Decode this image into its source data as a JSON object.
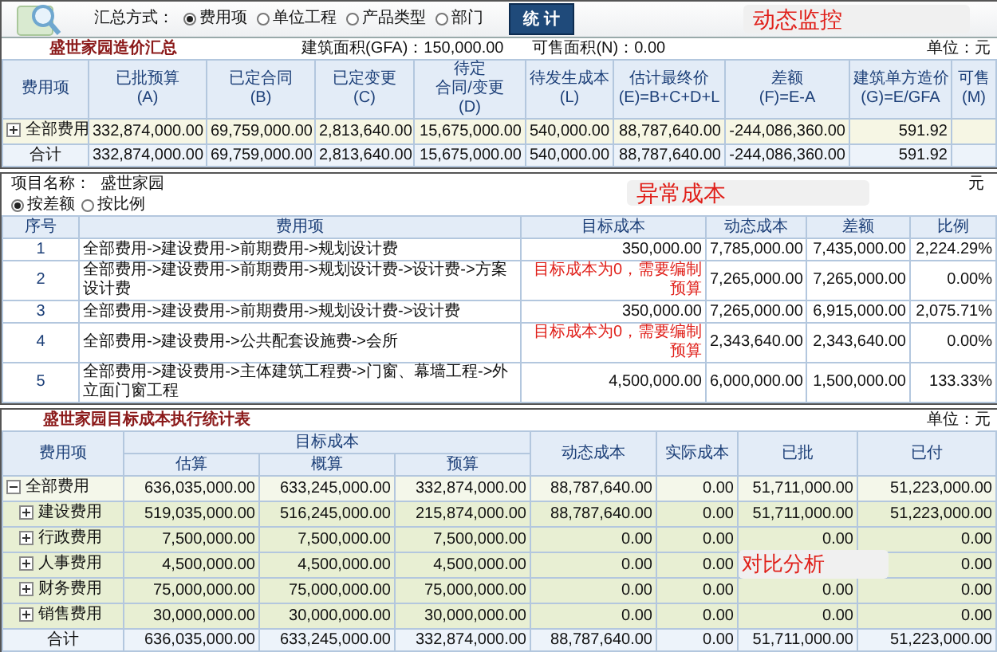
{
  "toolbar": {
    "summary_label": "汇总方式：",
    "summary_options": [
      {
        "label": "费用项",
        "selected": true
      },
      {
        "label": "单位工程",
        "selected": false
      },
      {
        "label": "产品类型",
        "selected": false
      },
      {
        "label": "部门",
        "selected": false
      }
    ],
    "button": "统 计",
    "annotation": "动态监控"
  },
  "cost_summary": {
    "title": "盛世家园造价汇总",
    "gfa": "建筑面积(GFA)：150,000.00",
    "saleable_area": "可售面积(N)：0.00",
    "unit": "单位：元",
    "columns": [
      [
        "费用项"
      ],
      [
        "已批预算",
        "(A)"
      ],
      [
        "已定合同",
        "(B)"
      ],
      [
        "已定变更",
        "(C)"
      ],
      [
        "待定",
        "合同/变更",
        "(D)"
      ],
      [
        "待发生成本",
        "(L)"
      ],
      [
        "估计最终价",
        "(E)=B+C+D+L"
      ],
      [
        "差额",
        "(F)=E-A"
      ],
      [
        "建筑单方造价",
        "(G)=E/GFA"
      ],
      [
        "可售",
        "(M)"
      ]
    ],
    "rows": [
      {
        "name": "全部费用",
        "expanded": false,
        "values": [
          "332,874,000.00",
          "69,759,000.00",
          "2,813,640.00",
          "15,675,000.00",
          "540,000.00",
          "88,787,640.00",
          "-244,086,360.00",
          "591.92"
        ]
      }
    ],
    "total": {
      "name": "合计",
      "values": [
        "332,874,000.00",
        "69,759,000.00",
        "2,813,640.00",
        "15,675,000.00",
        "540,000.00",
        "88,787,640.00",
        "-244,086,360.00",
        "591.92"
      ]
    }
  },
  "abnormal_cost": {
    "project_label": "项目名称：",
    "project_name": "盛世家园",
    "unit": "元",
    "annotation": "异常成本",
    "sort_options": [
      {
        "label": "按差额",
        "selected": true
      },
      {
        "label": "按比例",
        "selected": false
      }
    ],
    "columns": [
      "序号",
      "费用项",
      "目标成本",
      "动态成本",
      "差额",
      "比例"
    ],
    "rows": [
      {
        "no": "1",
        "item": "全部费用->建设费用->前期费用->规划设计费",
        "target": "350,000.00",
        "warning": false,
        "dynamic": "7,785,000.00",
        "difference": "7,435,000.00",
        "ratio": "2,224.29%"
      },
      {
        "no": "2",
        "item": "全部费用->建设费用->前期费用->规划设计费->设计费->方案设计费",
        "target": "目标成本为0，需要编制预算",
        "warning": true,
        "dynamic": "7,265,000.00",
        "difference": "7,265,000.00",
        "ratio": "0.00%"
      },
      {
        "no": "3",
        "item": "全部费用->建设费用->前期费用->规划设计费->设计费",
        "target": "350,000.00",
        "warning": false,
        "dynamic": "7,265,000.00",
        "difference": "6,915,000.00",
        "ratio": "2,075.71%"
      },
      {
        "no": "4",
        "item": "全部费用->建设费用->公共配套设施费->会所",
        "target": "目标成本为0，需要编制预算",
        "warning": true,
        "dynamic": "2,343,640.00",
        "difference": "2,343,640.00",
        "ratio": "0.00%"
      },
      {
        "no": "5",
        "item": "全部费用->建设费用->主体建筑工程费->门窗、幕墙工程->外立面门窗工程",
        "target": "4,500,000.00",
        "warning": false,
        "dynamic": "6,000,000.00",
        "difference": "1,500,000.00",
        "ratio": "133.33%"
      }
    ]
  },
  "target_cost": {
    "title": "盛世家园目标成本执行统计表",
    "unit": "单位：元",
    "annotation": "对比分析",
    "item_column": "费用项",
    "group_column": "目标成本",
    "sub_columns": [
      "估算",
      "概算",
      "预算"
    ],
    "other_columns": [
      "动态成本",
      "实际成本",
      "已批",
      "已付"
    ],
    "rows": [
      {
        "name": "全部费用",
        "expanded": true,
        "values": [
          "636,035,000.00",
          "633,245,000.00",
          "332,874,000.00",
          "88,787,640.00",
          "0.00",
          "51,711,000.00",
          "51,223,000.00"
        ],
        "children": [
          {
            "name": "建设费用",
            "expanded": false,
            "values": [
              "519,035,000.00",
              "516,245,000.00",
              "215,874,000.00",
              "88,787,640.00",
              "0.00",
              "51,711,000.00",
              "51,223,000.00"
            ]
          },
          {
            "name": "行政费用",
            "expanded": false,
            "values": [
              "7,500,000.00",
              "7,500,000.00",
              "7,500,000.00",
              "0.00",
              "0.00",
              "0.00",
              "0.00"
            ]
          },
          {
            "name": "人事费用",
            "expanded": false,
            "annotated": true,
            "values": [
              "4,500,000.00",
              "4,500,000.00",
              "4,500,000.00",
              "0.00",
              "0.00",
              "0.00"
            ]
          },
          {
            "name": "财务费用",
            "expanded": false,
            "values": [
              "75,000,000.00",
              "75,000,000.00",
              "75,000,000.00",
              "0.00",
              "0.00",
              "0.00",
              "0.00"
            ]
          },
          {
            "name": "销售费用",
            "expanded": false,
            "values": [
              "30,000,000.00",
              "30,000,000.00",
              "30,000,000.00",
              "0.00",
              "0.00",
              "0.00",
              "0.00"
            ]
          }
        ]
      }
    ],
    "total": {
      "name": "合计",
      "values": [
        "636,035,000.00",
        "633,245,000.00",
        "332,874,000.00",
        "88,787,640.00",
        "0.00",
        "51,711,000.00",
        "51,223,000.00"
      ]
    }
  }
}
